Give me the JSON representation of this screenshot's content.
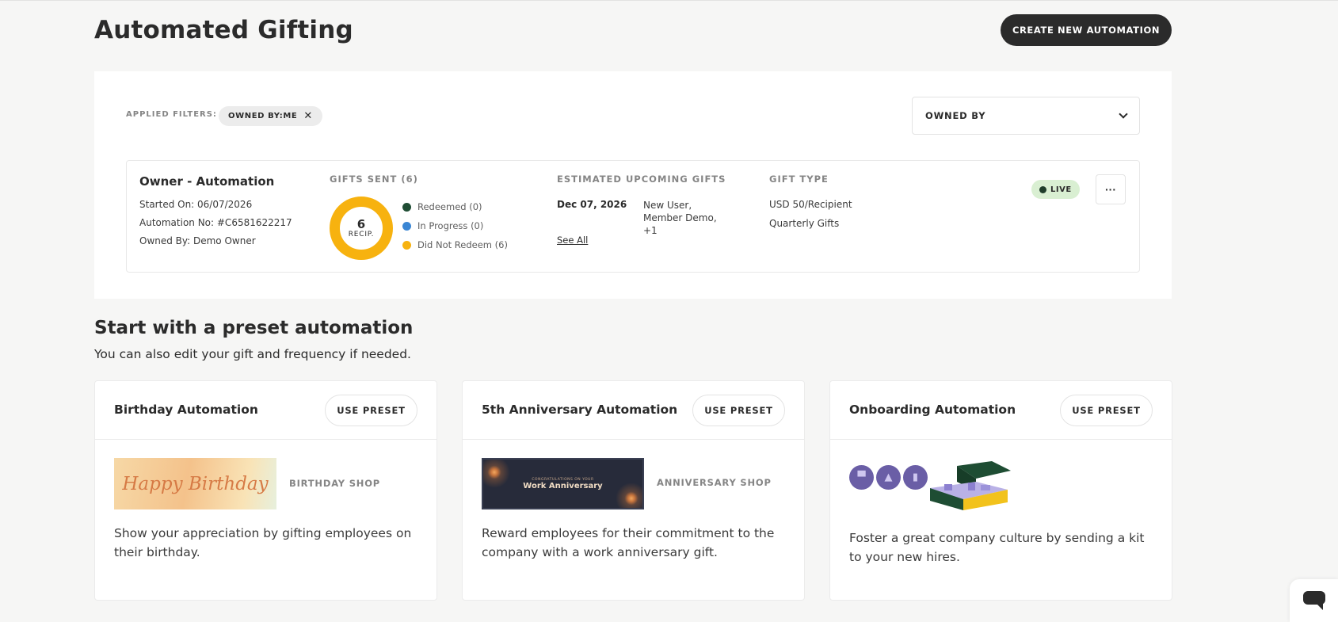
{
  "page": {
    "title": "Automated Gifting",
    "create_button": "CREATE NEW AUTOMATION"
  },
  "filters": {
    "label": "APPLIED FILTERS:",
    "chip": "OWNED BY:ME",
    "owned_by_select": "OWNED BY"
  },
  "automation": {
    "name": "Owner - Automation",
    "started_on": "Started On: 06/07/2026",
    "automation_no": "Automation No: #C6581622217",
    "owned_by": "Owned By: Demo Owner",
    "gifts_sent_label": "GIFTS SENT (6)",
    "donut_count": "6",
    "donut_unit": "RECIP.",
    "legend": [
      {
        "label": "Redeemed (0)",
        "color": "#1f4d34"
      },
      {
        "label": "In Progress (0)",
        "color": "#3a86d4"
      },
      {
        "label": "Did Not Redeem (6)",
        "color": "#f7b20f"
      }
    ],
    "upcoming_label": "ESTIMATED UPCOMING GIFTS",
    "upcoming_date": "Dec 07, 2026",
    "upcoming_recipients": "New User, Member Demo, +1",
    "see_all": "See All",
    "gift_type_label": "GIFT TYPE",
    "gift_amount": "USD 50/Recipient",
    "gift_name": "Quarterly Gifts",
    "status": "LIVE",
    "more_icon": "ellipsis-icon"
  },
  "presets": {
    "title": "Start with a preset automation",
    "subtitle": "You can also edit your gift and frequency if needed.",
    "cards": [
      {
        "title": "Birthday Automation",
        "button": "USE PRESET",
        "shop": "BIRTHDAY SHOP",
        "image_text": "Happy Birthday",
        "description": "Show your appreciation by gifting employees on their birthday."
      },
      {
        "title": "5th Anniversary Automation",
        "button": "USE PRESET",
        "shop": "ANNIVERSARY SHOP",
        "image_small_text": "CONGRATULATIONS ON YOUR",
        "image_text": "Work Anniversary",
        "description": "Reward employees for their commitment to the company with a work anniversary gift."
      },
      {
        "title": "Onboarding Automation",
        "button": "USE PRESET",
        "description": "Foster a great company culture by sending a kit to your new hires."
      }
    ]
  },
  "chat_widget_icon": "chat-icon"
}
